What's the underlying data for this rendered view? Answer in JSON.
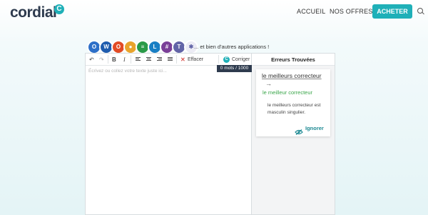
{
  "header": {
    "logo_text": "cordial",
    "logo_badge": "C",
    "nav": [
      "ACCUEIL",
      "NOS OFFRES"
    ],
    "cta_label": "ACHETER",
    "search_icon": "search-icon",
    "accent_color": "#1fb0b8"
  },
  "apps": {
    "icons": [
      "outlook-icon",
      "word-icon",
      "office-icon",
      "chrome-icon",
      "google-docs-icon",
      "libreoffice-icon",
      "slack-icon",
      "teams-icon",
      "apps-more-icon"
    ],
    "tagline": "... et bien d'autres applications !"
  },
  "editor": {
    "toolbar": {
      "undo_icon": "undo-icon",
      "redo_icon": "redo-icon",
      "bold_label": "B",
      "italic_label": "I",
      "clear_label": "Effacer",
      "correct_label": "Corriger"
    },
    "word_count": "0 mots / 1000",
    "placeholder": "Écrivez ou collez votre texte juste ici..."
  },
  "errors": {
    "title": "Erreurs Trouvées",
    "items": [
      {
        "wrong": "le meilleurs correcteur",
        "arrow": "→",
        "correction": "le meilleur correcteur",
        "explanation": "le meilleurs correcteur est masculin singulier.",
        "ignore_label": "Ignorer"
      }
    ]
  }
}
